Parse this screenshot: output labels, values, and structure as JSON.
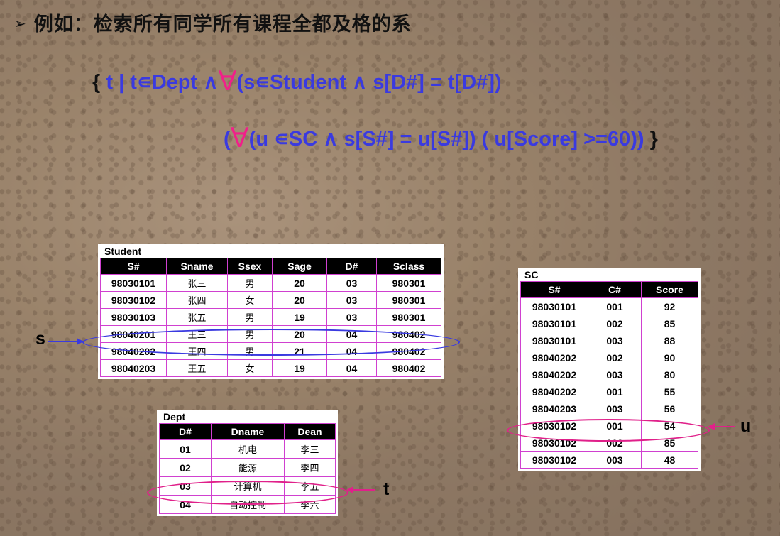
{
  "title": {
    "bullet": "➢",
    "text": "例如：检索所有同学所有课程全都及格的系"
  },
  "formula": {
    "line1": {
      "brace_open": "{",
      "part_a": " t |  t∊Dept ∧",
      "forall": "∀",
      "part_b": "(s∊Student ∧ s[D#] = t[D#])"
    },
    "line2": {
      "paren": "(",
      "forall": "∀",
      "part": "(u ∊SC ∧ s[S#] = u[S#]) ( u[Score] >=60))",
      "brace_close": " }"
    }
  },
  "student": {
    "caption": "Student",
    "headers": [
      "S#",
      "Sname",
      "Ssex",
      "Sage",
      "D#",
      "Sclass"
    ],
    "rows": [
      [
        "98030101",
        "张三",
        "男",
        "20",
        "03",
        "980301"
      ],
      [
        "98030102",
        "张四",
        "女",
        "20",
        "03",
        "980301"
      ],
      [
        "98030103",
        "张五",
        "男",
        "19",
        "03",
        "980301"
      ],
      [
        "98040201",
        "王三",
        "男",
        "20",
        "04",
        "980402"
      ],
      [
        "98040202",
        "王四",
        "男",
        "21",
        "04",
        "980402"
      ],
      [
        "98040203",
        "王五",
        "女",
        "19",
        "04",
        "980402"
      ]
    ]
  },
  "sc": {
    "caption": "SC",
    "headers": [
      "S#",
      "C#",
      "Score"
    ],
    "rows": [
      [
        "98030101",
        "001",
        "92"
      ],
      [
        "98030101",
        "002",
        "85"
      ],
      [
        "98030101",
        "003",
        "88"
      ],
      [
        "98040202",
        "002",
        "90"
      ],
      [
        "98040202",
        "003",
        "80"
      ],
      [
        "98040202",
        "001",
        "55"
      ],
      [
        "98040203",
        "003",
        "56"
      ],
      [
        "98030102",
        "001",
        "54"
      ],
      [
        "98030102",
        "002",
        "85"
      ],
      [
        "98030102",
        "003",
        "48"
      ]
    ]
  },
  "dept": {
    "caption": "Dept",
    "headers": [
      "D#",
      "Dname",
      "Dean"
    ],
    "rows": [
      [
        "01",
        "机电",
        "李三"
      ],
      [
        "02",
        "能源",
        "李四"
      ],
      [
        "03",
        "计算机",
        "李五"
      ],
      [
        "04",
        "自动控制",
        "李六"
      ]
    ]
  },
  "labels": {
    "s": "s",
    "u": "u",
    "t": "t"
  },
  "colors": {
    "formula": "#3a3ae0",
    "forall": "#f0208a",
    "s_marker": "#3a3ae0",
    "t_marker": "#e0208a",
    "u_marker": "#e0208a",
    "table_border": "#d040d0"
  }
}
